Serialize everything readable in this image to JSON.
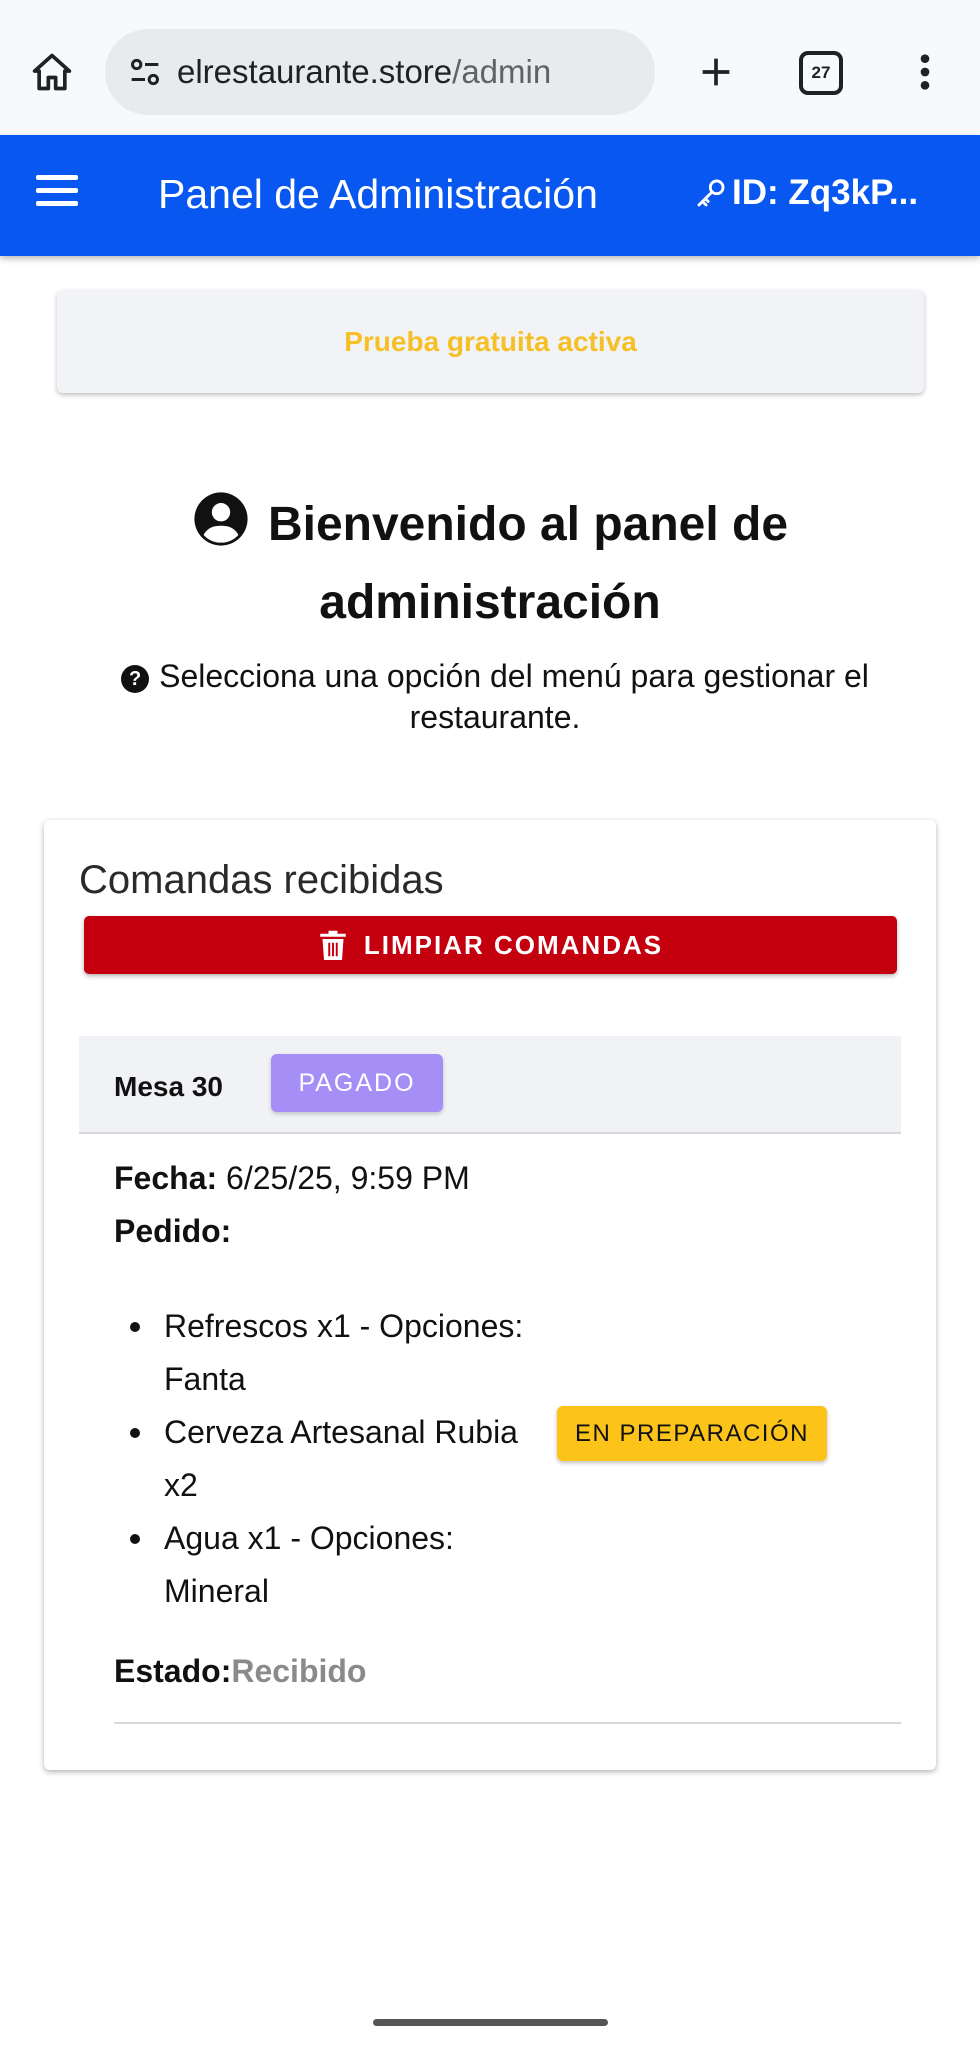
{
  "browser": {
    "url_host": "elrestaurante.store",
    "url_path": "/admin",
    "tab_count": "27"
  },
  "header": {
    "title": "Panel de Administración",
    "id_label": "ID: Zq3kP..."
  },
  "trial_banner": {
    "text": "Prueba gratuita activa"
  },
  "welcome": {
    "title": "Bienvenido al panel de administración",
    "subtitle": "Selecciona una opción del menú para gestionar el restaurante."
  },
  "orders": {
    "title": "Comandas recibidas",
    "clear_label": "LIMPIAR COMANDAS",
    "order": {
      "table": "Mesa 30",
      "paid_badge": "PAGADO",
      "date_label": "Fecha:",
      "date_value": "6/25/25, 9:59 PM",
      "items_label": "Pedido:",
      "items": [
        {
          "text": "Refrescos x1 - Opciones: Fanta",
          "badge": ""
        },
        {
          "text": "Cerveza Artesanal Rubia x2",
          "badge": "EN PREPARACIÓN"
        },
        {
          "text": "Agua x1 - Opciones: Mineral",
          "badge": ""
        }
      ],
      "status_label": "Estado:",
      "status_value": "Recibido"
    }
  },
  "colors": {
    "header_bg": "#0757f0",
    "trial_text": "#f6bf26",
    "clear_button": "#c5000e",
    "paid_badge": "#a58ff7",
    "prep_badge": "#fcc419"
  }
}
